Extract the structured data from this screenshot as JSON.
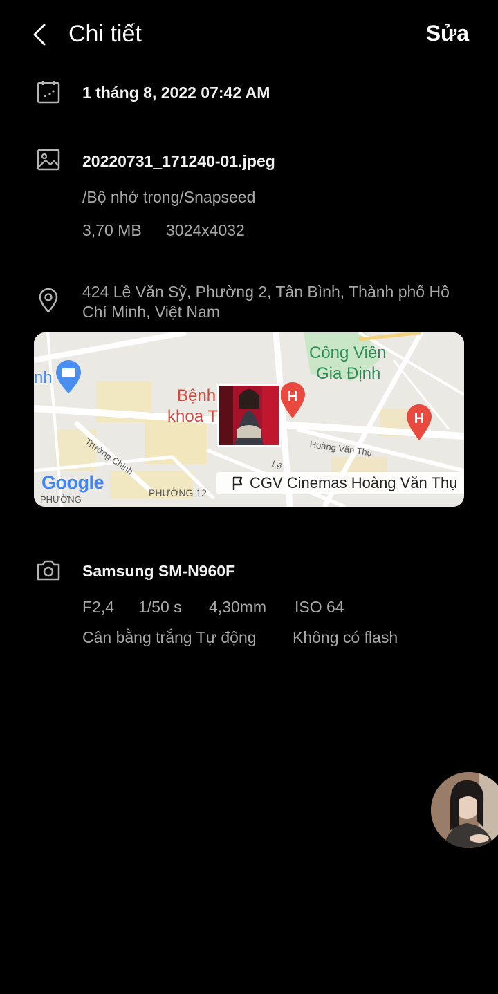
{
  "header": {
    "title": "Chi tiết",
    "edit_label": "Sửa"
  },
  "date": {
    "text": "1 tháng 8, 2022 07:42 AM"
  },
  "file": {
    "name": "20220731_171240-01.jpeg",
    "path": "/Bộ nhớ trong/Snapseed",
    "size": "3,70 MB",
    "resolution": "3024x4032"
  },
  "location": {
    "address": "424 Lê Văn Sỹ, Phường 2, Tân Bình, Thành phố Hồ Chí Minh, Việt Nam",
    "map": {
      "labels": {
        "park_line1": "Công Viên",
        "park_line2": "Gia Định",
        "hospital_line1": "Bệnh",
        "hospital_line2": "khoa T",
        "street_truong_chinh": "Trường Chinh",
        "street_hoang_van_thu": "Hoàng Văn Thụ",
        "street_le": "Lê",
        "ward": "PHƯỜNG 12",
        "ward2": "PHƯỜNG",
        "edge_text": "nh",
        "logo": "Google"
      },
      "place": "CGV Cinemas Hoàng Văn Thụ"
    }
  },
  "camera": {
    "model": "Samsung SM-N960F",
    "aperture": "F2,4",
    "shutter": "1/50 s",
    "focal": "4,30mm",
    "iso": "ISO 64",
    "white_balance": "Cân bằng trắng Tự động",
    "flash": "Không có flash"
  },
  "icons": {
    "back": "back-arrow-icon",
    "calendar": "calendar-icon",
    "image": "image-icon",
    "location": "location-pin-icon",
    "camera": "camera-icon",
    "place": "flag-icon"
  },
  "colors": {
    "background": "#000000",
    "primary_text": "#f2f2f2",
    "secondary_text": "#a8a8a8",
    "map_park_text": "#2e8b57",
    "map_hospital": "#e84a3f",
    "map_shop_pin": "#4a8ef0"
  }
}
